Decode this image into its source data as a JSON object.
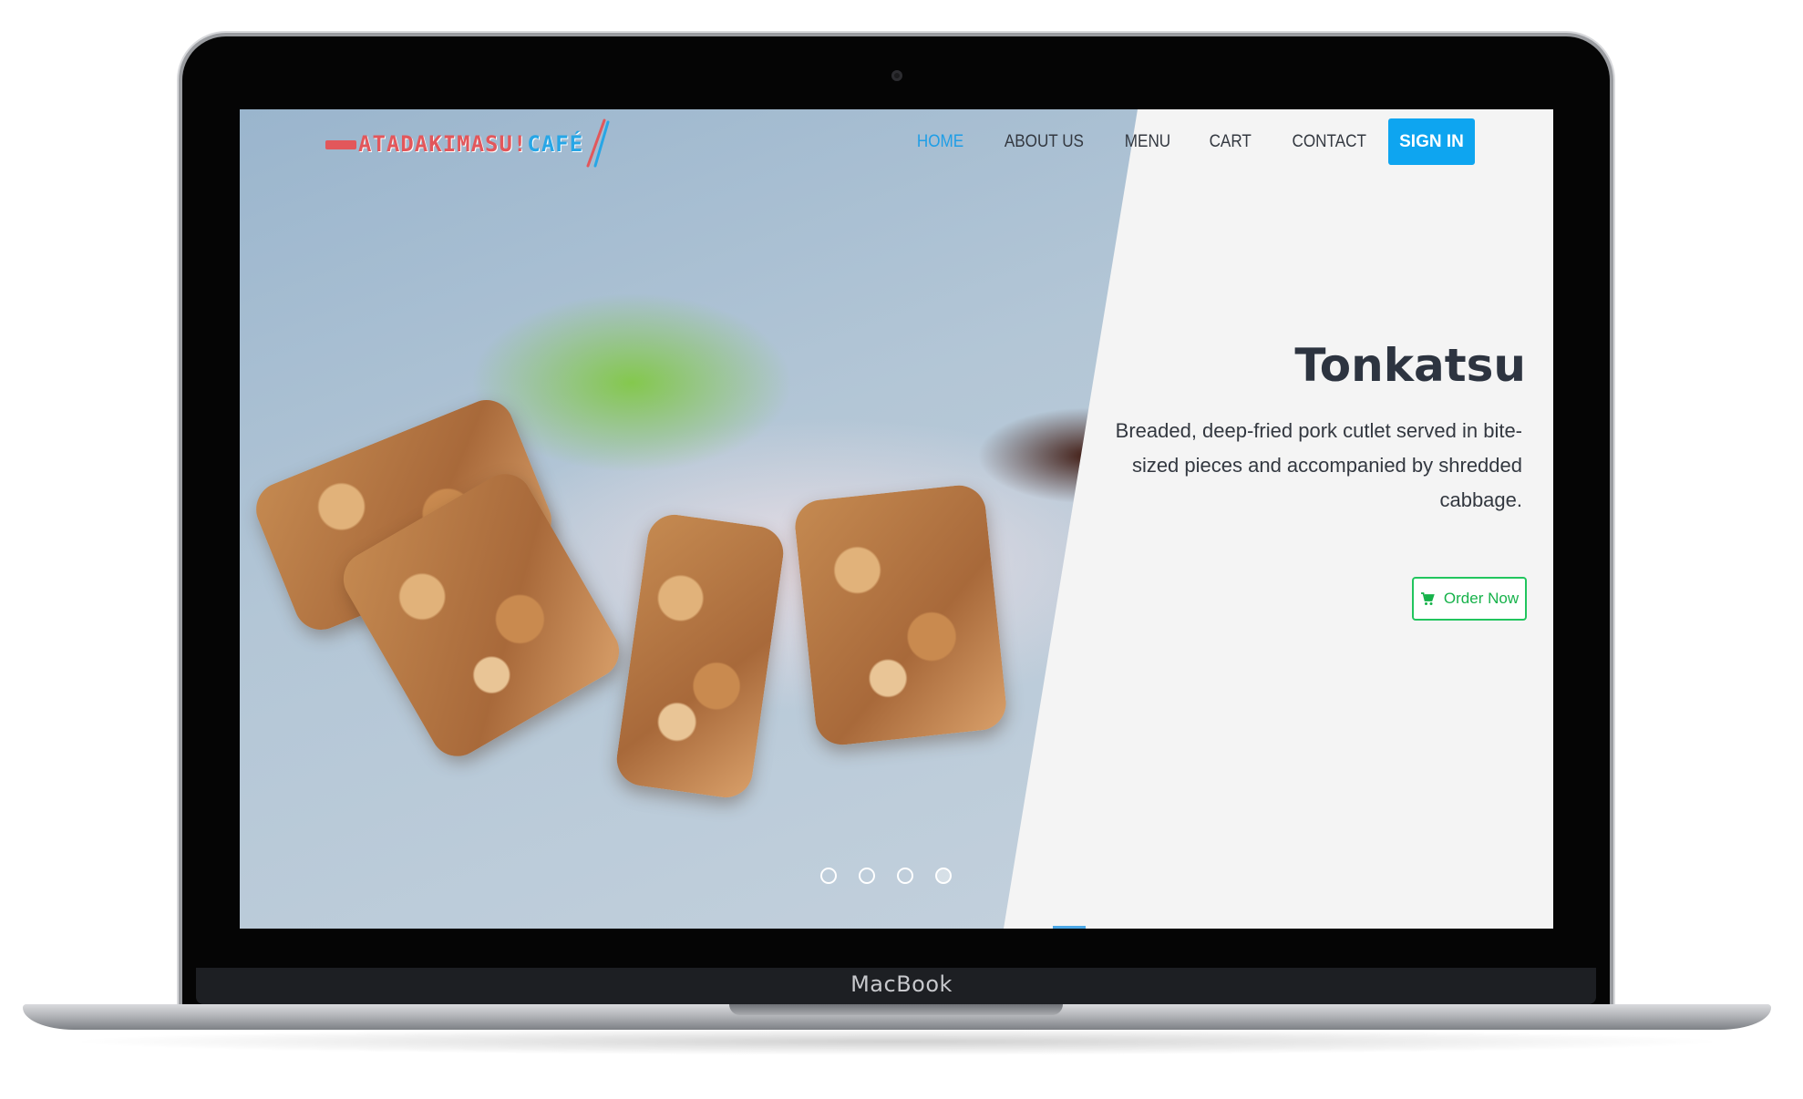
{
  "device": {
    "brand_label": "MacBook"
  },
  "logo": {
    "text_main": "ATADAKIMASU!",
    "text_cafe": "CAFÉ",
    "icon": "chopsticks-icon"
  },
  "nav": {
    "items": [
      {
        "label": "HOME",
        "active": true
      },
      {
        "label": "ABOUT US",
        "active": false
      },
      {
        "label": "MENU",
        "active": false
      },
      {
        "label": "CART",
        "active": false
      },
      {
        "label": "CONTACT",
        "active": false
      }
    ],
    "signin_label": "SIGN IN"
  },
  "hero": {
    "title": "Tonkatsu",
    "description": "Breaded, deep-fried pork cutlet served in bite-sized pieces and accompanied by shredded cabbage.",
    "order_label": "Order Now",
    "order_icon": "cart-icon",
    "slides_total": 4,
    "active_slide": 4
  },
  "colors": {
    "accent_blue": "#0ea5f0",
    "active_nav": "#1f9ee6",
    "order_green": "#22c55e",
    "logo_red": "#e2575b"
  }
}
